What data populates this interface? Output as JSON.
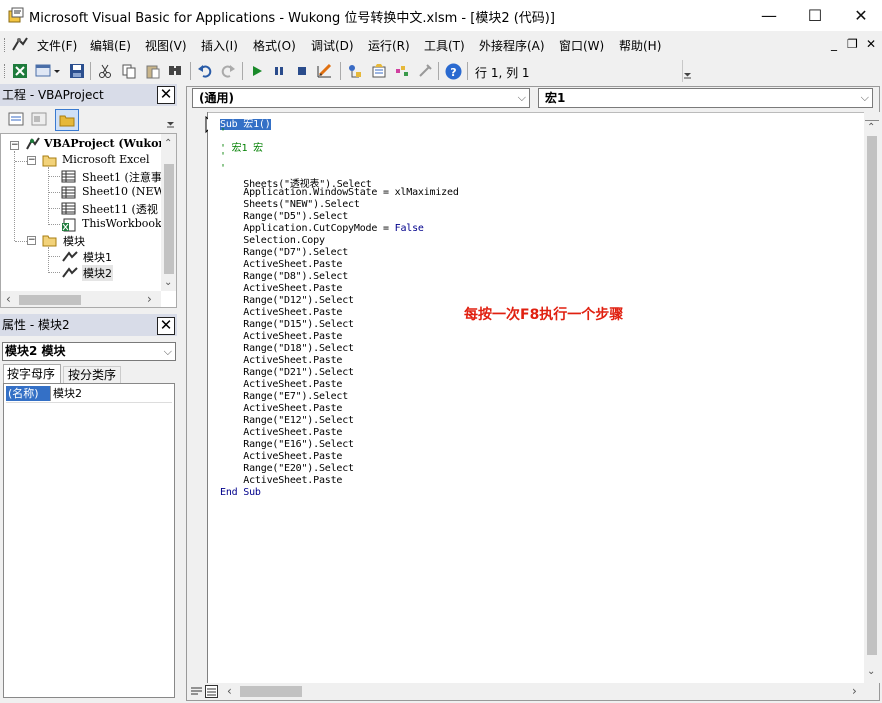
{
  "window": {
    "title": "Microsoft Visual Basic for Applications - Wukong  位号转换中文.xlsm - [模块2 (代码)]",
    "minimize": "—",
    "maximize": "☐",
    "close": "✕"
  },
  "menu": {
    "items": [
      "文件(F)",
      "编辑(E)",
      "视图(V)",
      "插入(I)",
      "格式(O)",
      "调试(D)",
      "运行(R)",
      "工具(T)",
      "外接程序(A)",
      "窗口(W)",
      "帮助(H)"
    ],
    "mdi_min": "_",
    "mdi_restore": "❐",
    "mdi_close": "✕"
  },
  "toolbar": {
    "position": "行 1, 列 1"
  },
  "project_panel": {
    "title": "工程 - VBAProject",
    "close": "✕",
    "tree": {
      "root": "VBAProject (Wukon",
      "folder_excel": "Microsoft Excel",
      "sheet1": "Sheet1 (注意事",
      "sheet10": "Sheet10 (NEW)",
      "sheet11": "Sheet11 (透视",
      "thisworkbook": "ThisWorkbook",
      "folder_modules": "模块",
      "module1": "模块1",
      "module2": "模块2"
    }
  },
  "properties_panel": {
    "title": "属性 - 模块2",
    "close": "✕",
    "object_select": "模块2 模块",
    "tab_alpha": "按字母序",
    "tab_category": "按分类序",
    "prop_name": "(名称)",
    "prop_value": "模块2"
  },
  "code_window": {
    "object_combo": "(通用)",
    "proc_combo": "宏1",
    "annotation": "每按一次F8执行一个步骤",
    "annotation_color": "#e02010",
    "lines": [
      {
        "t": "Sub 宏1()",
        "k": "sel"
      },
      {
        "t": "'",
        "k": "cm"
      },
      {
        "t": "' 宏1 宏",
        "k": "cm"
      },
      {
        "t": "'",
        "k": "cm"
      },
      {
        "t": "'",
        "k": "cm"
      },
      {
        "t": "    Sheets(\"透视表\").Select",
        "k": ""
      },
      {
        "t": "    Application.WindowState = xlMaximized",
        "k": ""
      },
      {
        "t": "    Sheets(\"NEW\").Select",
        "k": ""
      },
      {
        "t": "    Range(\"D5\").Select",
        "k": ""
      },
      {
        "t": "    Application.CutCopyMode = False",
        "k": "false"
      },
      {
        "t": "    Selection.Copy",
        "k": ""
      },
      {
        "t": "    Range(\"D7\").Select",
        "k": ""
      },
      {
        "t": "    ActiveSheet.Paste",
        "k": ""
      },
      {
        "t": "    Range(\"D8\").Select",
        "k": ""
      },
      {
        "t": "    ActiveSheet.Paste",
        "k": ""
      },
      {
        "t": "    Range(\"D12\").Select",
        "k": ""
      },
      {
        "t": "    ActiveSheet.Paste",
        "k": ""
      },
      {
        "t": "    Range(\"D15\").Select",
        "k": ""
      },
      {
        "t": "    ActiveSheet.Paste",
        "k": ""
      },
      {
        "t": "    Range(\"D18\").Select",
        "k": ""
      },
      {
        "t": "    ActiveSheet.Paste",
        "k": ""
      },
      {
        "t": "    Range(\"D21\").Select",
        "k": ""
      },
      {
        "t": "    ActiveSheet.Paste",
        "k": ""
      },
      {
        "t": "    Range(\"E7\").Select",
        "k": ""
      },
      {
        "t": "    ActiveSheet.Paste",
        "k": ""
      },
      {
        "t": "    Range(\"E12\").Select",
        "k": ""
      },
      {
        "t": "    ActiveSheet.Paste",
        "k": ""
      },
      {
        "t": "    Range(\"E16\").Select",
        "k": ""
      },
      {
        "t": "    ActiveSheet.Paste",
        "k": ""
      },
      {
        "t": "    Range(\"E20\").Select",
        "k": ""
      },
      {
        "t": "    ActiveSheet.Paste",
        "k": ""
      },
      {
        "t": "End Sub",
        "k": "kw"
      }
    ]
  }
}
